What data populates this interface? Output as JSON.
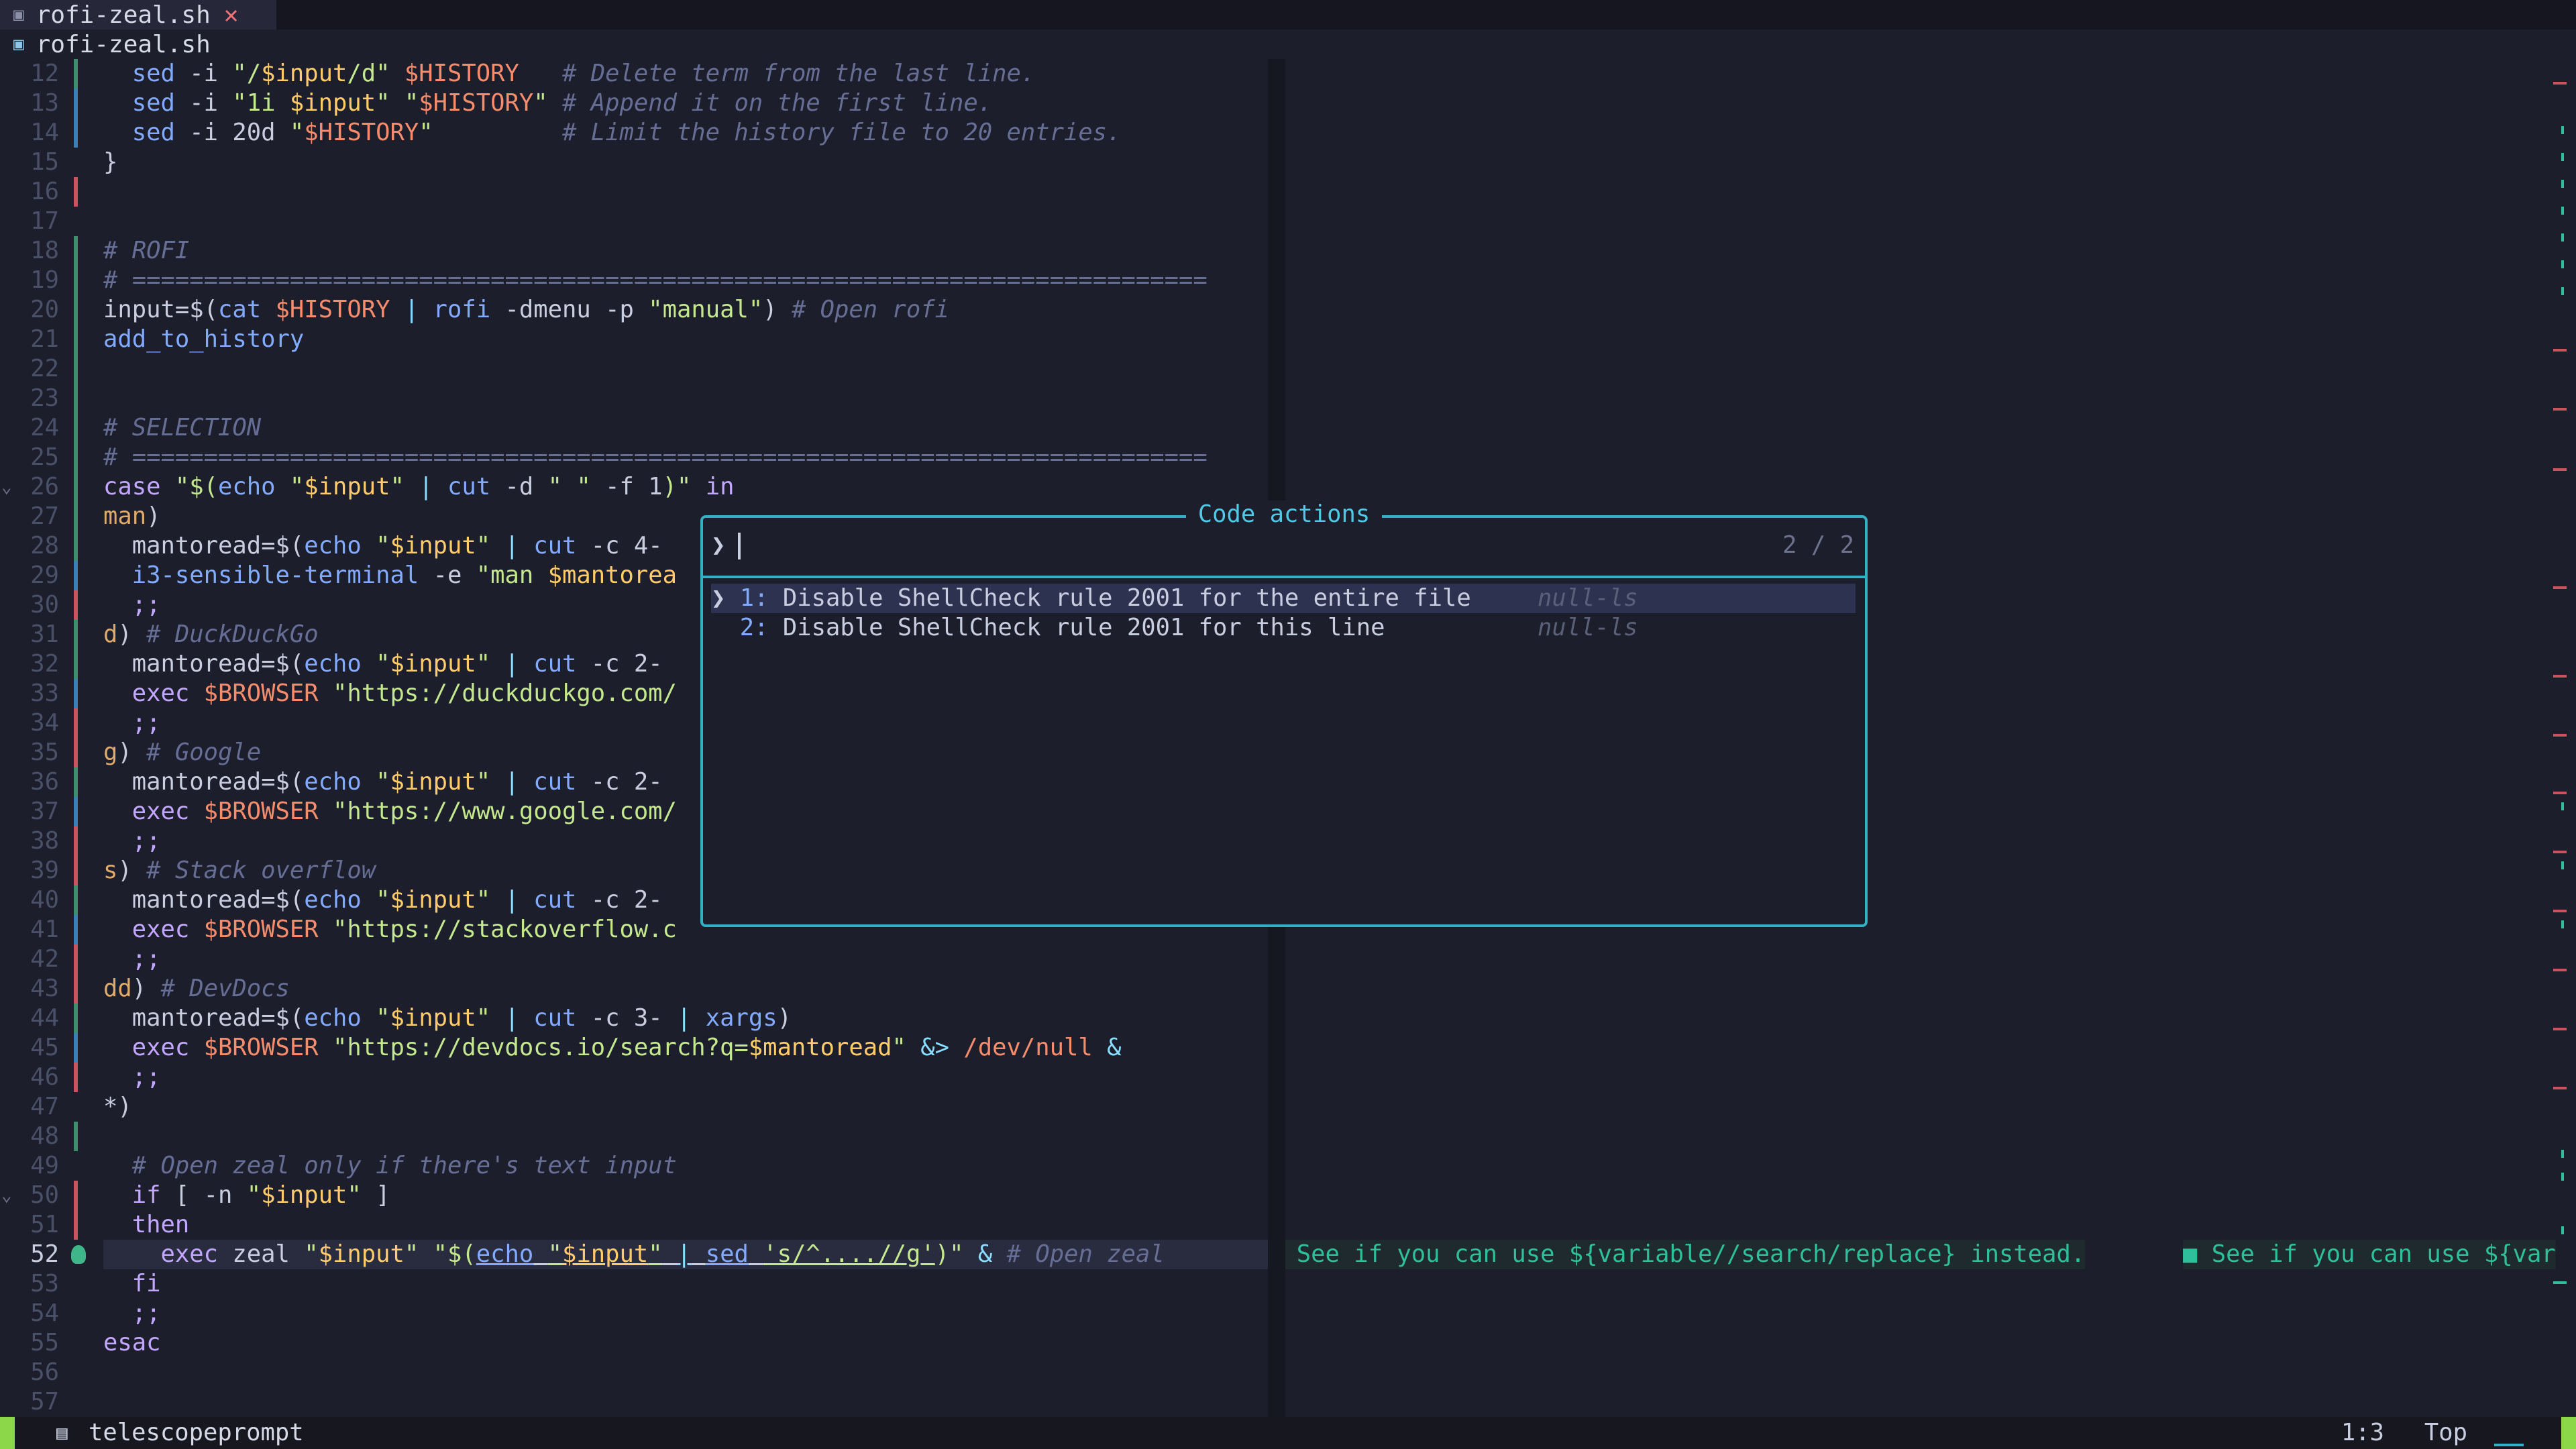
{
  "tab": {
    "title": "rofi-zeal.sh",
    "close": "✕"
  },
  "winbar": {
    "title": "rofi-zeal.sh"
  },
  "lines": [
    {
      "n": "12",
      "sign": "add",
      "fold": "",
      "code": "<span class='k'>  </span><span class='fn'>sed</span><span class='k'> -i </span><span class='st'>\"/</span><span class='vv'>$input</span><span class='st'>/d\"</span><span class='k'> </span><span class='vr'>$HISTORY</span><span class='k'>   </span><span class='cm'># Delete term from the last line.</span>"
    },
    {
      "n": "13",
      "sign": "mod",
      "fold": "",
      "code": "<span class='k'>  </span><span class='fn'>sed</span><span class='k'> -i </span><span class='st'>\"1i </span><span class='vv'>$input</span><span class='st'>\"</span><span class='k'> </span><span class='st'>\"</span><span class='vr'>$HISTORY</span><span class='st'>\"</span><span class='k'> </span><span class='cm'># Append it on the first line.</span>"
    },
    {
      "n": "14",
      "sign": "mod",
      "fold": "",
      "code": "<span class='k'>  </span><span class='fn'>sed</span><span class='k'> -i 20d </span><span class='st'>\"</span><span class='vr'>$HISTORY</span><span class='st'>\"</span><span class='k'>         </span><span class='cm'># Limit the history file to 20 entries.</span>"
    },
    {
      "n": "15",
      "sign": "",
      "fold": "",
      "code": "<span class='k'>}</span>"
    },
    {
      "n": "16",
      "sign": "del",
      "fold": "",
      "code": ""
    },
    {
      "n": "17",
      "sign": "",
      "fold": "",
      "code": ""
    },
    {
      "n": "18",
      "sign": "add",
      "fold": "",
      "code": "<span class='cm'># ROFI</span>"
    },
    {
      "n": "19",
      "sign": "add",
      "fold": "",
      "code": "<span class='cm'># ===========================================================================</span>"
    },
    {
      "n": "20",
      "sign": "add",
      "fold": "",
      "code": "<span class='k'>input=$(</span><span class='fn'>cat</span><span class='k'> </span><span class='vr'>$HISTORY</span><span class='k'> </span><span class='op'>|</span><span class='k'> </span><span class='fn'>rofi</span><span class='k'> -dmenu -p </span><span class='st'>\"manual\"</span><span class='k'>) </span><span class='cm'># Open rofi</span>"
    },
    {
      "n": "21",
      "sign": "add",
      "fold": "",
      "code": "<span class='fn'>add_to_history</span>"
    },
    {
      "n": "22",
      "sign": "add",
      "fold": "",
      "code": ""
    },
    {
      "n": "23",
      "sign": "add",
      "fold": "",
      "code": ""
    },
    {
      "n": "24",
      "sign": "add",
      "fold": "",
      "code": "<span class='cm'># SELECTION</span>"
    },
    {
      "n": "25",
      "sign": "add",
      "fold": "",
      "code": "<span class='cm'># ===========================================================================</span>"
    },
    {
      "n": "26",
      "sign": "add",
      "fold": "⌄",
      "code": "<span class='kw'>case</span><span class='k'> </span><span class='st'>\"$(</span><span class='fn'>echo</span><span class='k'> </span><span class='st'>\"</span><span class='vv'>$input</span><span class='st'>\"</span><span class='k'> </span><span class='op'>|</span><span class='k'> </span><span class='fn'>cut</span><span class='k'> -d </span><span class='st'>\" \"</span><span class='k'> -f 1</span><span class='st'>)\"</span><span class='k'> </span><span class='kw'>in</span>"
    },
    {
      "n": "27",
      "sign": "add",
      "fold": "",
      "code": "<span class='cs'>man</span><span class='k'>)</span>"
    },
    {
      "n": "28",
      "sign": "add",
      "fold": "",
      "code": "<span class='k'>  mantoread=$(</span><span class='fn'>echo</span><span class='k'> </span><span class='st'>\"</span><span class='vv'>$input</span><span class='st'>\"</span><span class='k'> </span><span class='op'>|</span><span class='k'> </span><span class='fn'>cut</span><span class='k'> -c 4-</span>"
    },
    {
      "n": "29",
      "sign": "mod",
      "fold": "",
      "code": "<span class='k'>  </span><span class='fn'>i3-sensible-terminal</span><span class='k'> -e </span><span class='st'>\"man </span><span class='vv'>$mantorea</span>"
    },
    {
      "n": "30",
      "sign": "del",
      "fold": "",
      "code": "<span class='k'>  </span><span class='kw'>;;</span>"
    },
    {
      "n": "31",
      "sign": "add",
      "fold": "",
      "code": "<span class='cs'>d</span><span class='k'>) </span><span class='cm'># DuckDuckGo</span>"
    },
    {
      "n": "32",
      "sign": "add",
      "fold": "",
      "code": "<span class='k'>  mantoread=$(</span><span class='fn'>echo</span><span class='k'> </span><span class='st'>\"</span><span class='vv'>$input</span><span class='st'>\"</span><span class='k'> </span><span class='op'>|</span><span class='k'> </span><span class='fn'>cut</span><span class='k'> -c 2-</span>"
    },
    {
      "n": "33",
      "sign": "mod",
      "fold": "",
      "code": "<span class='k'>  </span><span class='kw'>exec</span><span class='k'> </span><span class='vr'>$BROWSER</span><span class='k'> </span><span class='st'>\"https://duckduckgo.com/</span>"
    },
    {
      "n": "34",
      "sign": "del",
      "fold": "",
      "code": "<span class='k'>  </span><span class='kw'>;;</span>"
    },
    {
      "n": "35",
      "sign": "del",
      "fold": "",
      "code": "<span class='cs'>g</span><span class='k'>) </span><span class='cm'># Google</span>"
    },
    {
      "n": "36",
      "sign": "add",
      "fold": "",
      "code": "<span class='k'>  mantoread=$(</span><span class='fn'>echo</span><span class='k'> </span><span class='st'>\"</span><span class='vv'>$input</span><span class='st'>\"</span><span class='k'> </span><span class='op'>|</span><span class='k'> </span><span class='fn'>cut</span><span class='k'> -c 2-</span>"
    },
    {
      "n": "37",
      "sign": "mod",
      "fold": "",
      "code": "<span class='k'>  </span><span class='kw'>exec</span><span class='k'> </span><span class='vr'>$BROWSER</span><span class='k'> </span><span class='st'>\"https://www.google.com/</span>"
    },
    {
      "n": "38",
      "sign": "del",
      "fold": "",
      "code": "<span class='k'>  </span><span class='kw'>;;</span>"
    },
    {
      "n": "39",
      "sign": "del",
      "fold": "",
      "code": "<span class='cs'>s</span><span class='k'>) </span><span class='cm'># Stack overflow</span>"
    },
    {
      "n": "40",
      "sign": "add",
      "fold": "",
      "code": "<span class='k'>  mantoread=$(</span><span class='fn'>echo</span><span class='k'> </span><span class='st'>\"</span><span class='vv'>$input</span><span class='st'>\"</span><span class='k'> </span><span class='op'>|</span><span class='k'> </span><span class='fn'>cut</span><span class='k'> -c 2-</span>"
    },
    {
      "n": "41",
      "sign": "mod",
      "fold": "",
      "code": "<span class='k'>  </span><span class='kw'>exec</span><span class='k'> </span><span class='vr'>$BROWSER</span><span class='k'> </span><span class='st'>\"https://stackoverflow.c</span>"
    },
    {
      "n": "42",
      "sign": "del",
      "fold": "",
      "code": "<span class='k'>  </span><span class='kw'>;;</span>"
    },
    {
      "n": "43",
      "sign": "del",
      "fold": "",
      "code": "<span class='cs'>dd</span><span class='k'>) </span><span class='cm'># DevDocs</span>"
    },
    {
      "n": "44",
      "sign": "add",
      "fold": "",
      "code": "<span class='k'>  mantoread=$(</span><span class='fn'>echo</span><span class='k'> </span><span class='st'>\"</span><span class='vv'>$input</span><span class='st'>\"</span><span class='k'> </span><span class='op'>|</span><span class='k'> </span><span class='fn'>cut</span><span class='k'> -c 3- </span><span class='op'>|</span><span class='k'> </span><span class='fn'>xargs</span><span class='k'>)</span>"
    },
    {
      "n": "45",
      "sign": "mod",
      "fold": "",
      "code": "<span class='k'>  </span><span class='kw'>exec</span><span class='k'> </span><span class='vr'>$BROWSER</span><span class='k'> </span><span class='st'>\"https://devdocs.io/search?q=</span><span class='vv'>$mantoread</span><span class='st'>\"</span><span class='k'> </span><span class='op'>&amp;&gt;</span><span class='k'> </span><span class='vr'>/dev/null</span><span class='k'> </span><span class='op'>&amp;</span>"
    },
    {
      "n": "46",
      "sign": "del",
      "fold": "",
      "code": "<span class='k'>  </span><span class='kw'>;;</span>"
    },
    {
      "n": "47",
      "sign": "",
      "fold": "",
      "code": "<span class='k'>*)</span>"
    },
    {
      "n": "48",
      "sign": "add",
      "fold": "",
      "code": ""
    },
    {
      "n": "49",
      "sign": "",
      "fold": "",
      "code": "<span class='k'>  </span><span class='cm'># Open zeal only if there's text input</span>"
    },
    {
      "n": "50",
      "sign": "del",
      "fold": "⌄",
      "code": "<span class='k'>  </span><span class='kw'>if</span><span class='k'> [ -n </span><span class='st'>\"</span><span class='vv'>$input</span><span class='st'>\"</span><span class='k'> ]</span>"
    },
    {
      "n": "51",
      "sign": "del",
      "fold": "",
      "code": "<span class='k'>  </span><span class='kw'>then</span>"
    },
    {
      "n": "52",
      "sign": "bulb",
      "fold": "",
      "current": true,
      "code": "<span class='k'>    </span><span class='kw'>exec</span><span class='k'> zeal </span><span class='st'>\"</span><span class='vv'>$input</span><span class='st'>\"</span><span class='k'> </span><span class='st'>\"$(</span><span class='fn' style='text-decoration:underline'>echo</span><span class='k' style='text-decoration:underline'> </span><span class='st' style='text-decoration:underline'>\"</span><span class='vv' style='text-decoration:underline'>$input</span><span class='st' style='text-decoration:underline'>\"</span><span class='k' style='text-decoration:underline'> </span><span class='op' style='text-decoration:underline'>|</span><span class='k' style='text-decoration:underline'> </span><span class='fn' style='text-decoration:underline'>sed</span><span class='k' style='text-decoration:underline'> </span><span class='st' style='text-decoration:underline'>'s/^..../</span><span class='st' style='text-decoration:underline'>/g'</span><span class='st'>)\"</span><span class='k'> </span><span class='op'>&amp;</span><span class='k'> </span><span class='cm'># Open zeal</span>"
    },
    {
      "n": "53",
      "sign": "",
      "fold": "",
      "code": "<span class='k'>  </span><span class='kw'>fi</span>"
    },
    {
      "n": "54",
      "sign": "",
      "fold": "",
      "code": "<span class='k'>  </span><span class='kw'>;;</span>"
    },
    {
      "n": "55",
      "sign": "",
      "fold": "",
      "code": "<span class='kw'>esac</span>"
    },
    {
      "n": "56",
      "sign": "",
      "fold": "",
      "code": ""
    },
    {
      "n": "57",
      "sign": "",
      "fold": "",
      "code": ""
    }
  ],
  "virtual_text": {
    "first": "■ See if you can use ${variable//search/replace} instead.",
    "second": "■ See if you can use ${var"
  },
  "code_actions": {
    "title": "Code actions",
    "prompt_prefix": "❯",
    "counter": "2 / 2",
    "results": [
      {
        "marker": "❯",
        "num": "1:",
        "label": "Disable ShellCheck rule 2001 for the entire file",
        "source": "null-ls",
        "selected": true
      },
      {
        "marker": " ",
        "num": "2:",
        "label": "Disable ShellCheck rule 2001 for this line",
        "source": "null-ls",
        "selected": false
      }
    ]
  },
  "statusline": {
    "filetype": "telescopeprompt",
    "position": "1:3",
    "scroll": "Top"
  }
}
